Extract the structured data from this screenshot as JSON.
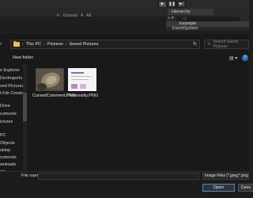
{
  "unity": {
    "play_icon": "play-icon",
    "pause_icon": "pause-icon",
    "step_icon": "step-icon",
    "gizmos_label": "Gizmos",
    "all_label": "All",
    "hierarchy_tab": "Hierarchy",
    "hierarchy_search_placeholder": "All",
    "scene_name": "Example",
    "event_system": "EventSystem"
  },
  "dialog": {
    "breadcrumb": [
      "This PC",
      "Pictures",
      "Saved Pictures"
    ],
    "search_placeholder": "Search Saved Pictures",
    "new_folder_label": "New folder",
    "nav_items": [
      {
        "label": "e Explorer"
      },
      {
        "label": "DevImports"
      },
      {
        "label": "ved Pictures"
      },
      {
        "label": "t File Creator"
      },
      {
        "label": "Drive"
      },
      {
        "label": "cuments"
      },
      {
        "label": "ictures"
      },
      {
        "label": "PC"
      },
      {
        "label": "Objects"
      },
      {
        "label": "sktop"
      },
      {
        "label": "cuments"
      },
      {
        "label": "wnloads"
      },
      {
        "label": "sic"
      },
      {
        "label": "ictures",
        "selected": true
      }
    ],
    "files": [
      {
        "name": "CursedComment.PNG"
      },
      {
        "name": "Personality.PNG"
      }
    ],
    "file_name_label": "File name:",
    "file_name_value": "",
    "file_type_filter": "Image Files (*.jpeg;*.png;*.",
    "open_label": "Open",
    "cancel_label": "Canc"
  }
}
